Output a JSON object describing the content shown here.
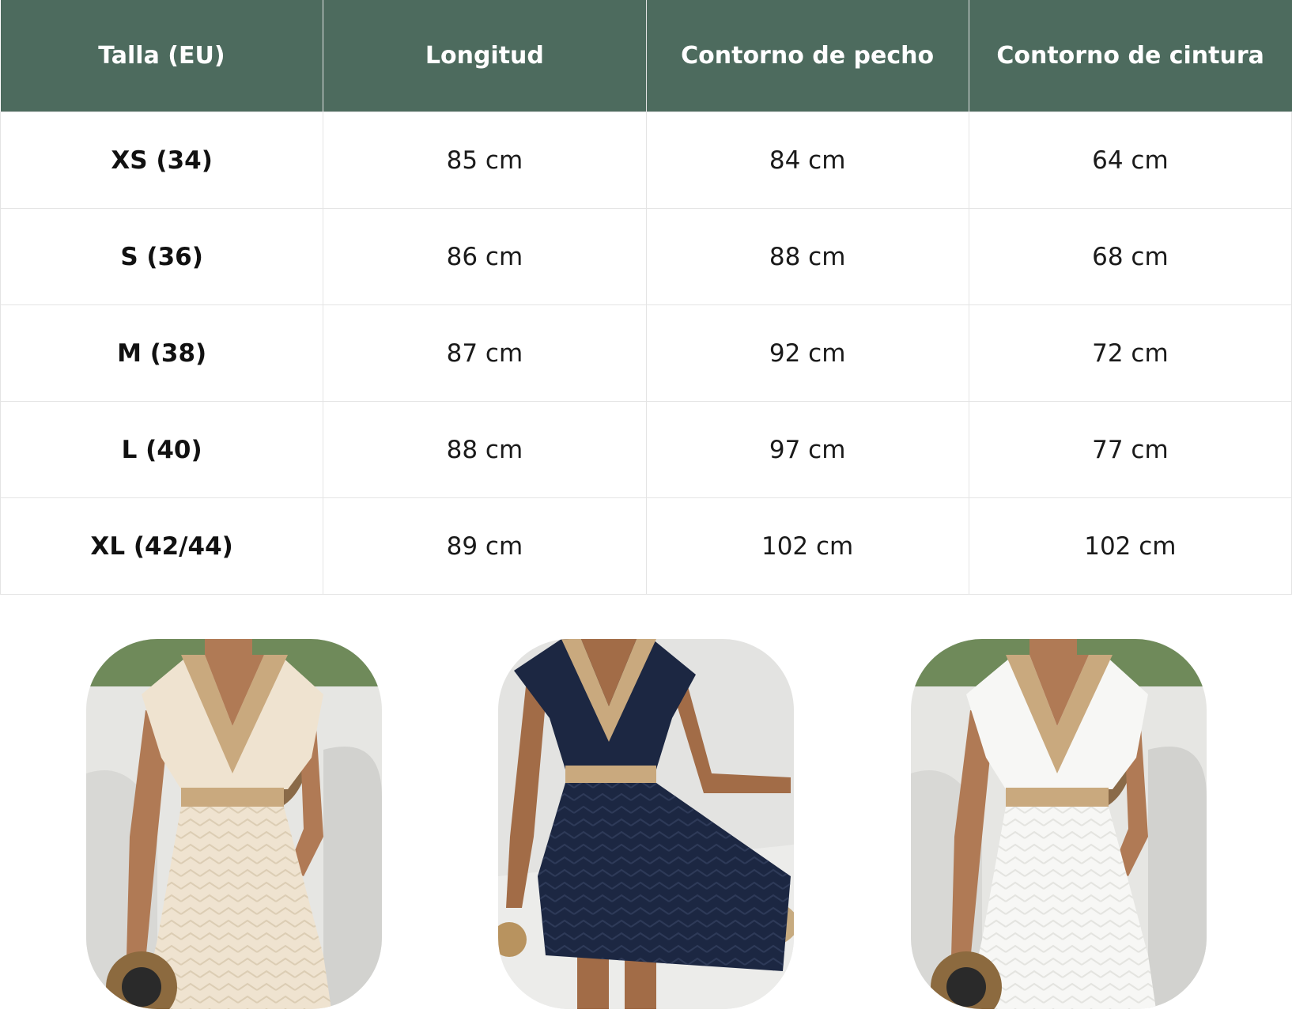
{
  "table": {
    "headers": [
      "Talla (EU)",
      "Longitud",
      "Contorno de pecho",
      "Contorno de cintura"
    ],
    "rows": [
      {
        "size": "XS (34)",
        "length": "85 cm",
        "chest": "84 cm",
        "waist": "64 cm"
      },
      {
        "size": "S (36)",
        "length": "86 cm",
        "chest": "88 cm",
        "waist": "68 cm"
      },
      {
        "size": "M (38)",
        "length": "87 cm",
        "chest": "92 cm",
        "waist": "72 cm"
      },
      {
        "size": "L (40)",
        "length": "88 cm",
        "chest": "97 cm",
        "waist": "77 cm"
      },
      {
        "size": "XL (42/44)",
        "length": "89 cm",
        "chest": "102 cm",
        "waist": "102 cm"
      }
    ]
  },
  "colors": {
    "header_bg": "#4d6b5e",
    "dress_beige": "#efe3d0",
    "dress_navy": "#1c2742",
    "dress_white": "#f7f7f5",
    "lace_trim": "#c9a97e"
  },
  "photos": [
    {
      "icon": "beige-dress-photo"
    },
    {
      "icon": "navy-dress-photo"
    },
    {
      "icon": "white-dress-photo"
    }
  ]
}
